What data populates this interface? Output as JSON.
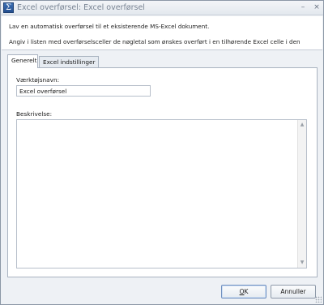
{
  "window": {
    "title": "Excel overførsel: Excel overførsel",
    "app_icon_glyph": "Σ",
    "minimize_glyph": "–",
    "close_glyph": "×"
  },
  "info": {
    "line1": "Lav en automatisk overførsel til et eksisterende MS-Excel dokument.",
    "line2": "Angiv i listen med overførselsceller de nøgletal som ønskes overført i en tilhørende Excel celle i den"
  },
  "tabs": [
    {
      "label": "Generelt",
      "active": true
    },
    {
      "label": "Excel indstillinger",
      "active": false
    }
  ],
  "general": {
    "tool_name_label": "Værktøjsnavn:",
    "tool_name_value": "Excel overførsel",
    "description_label": "Beskrivelse:",
    "description_value": ""
  },
  "buttons": {
    "ok_first": "O",
    "ok_rest": "K",
    "cancel": "Annuller"
  }
}
